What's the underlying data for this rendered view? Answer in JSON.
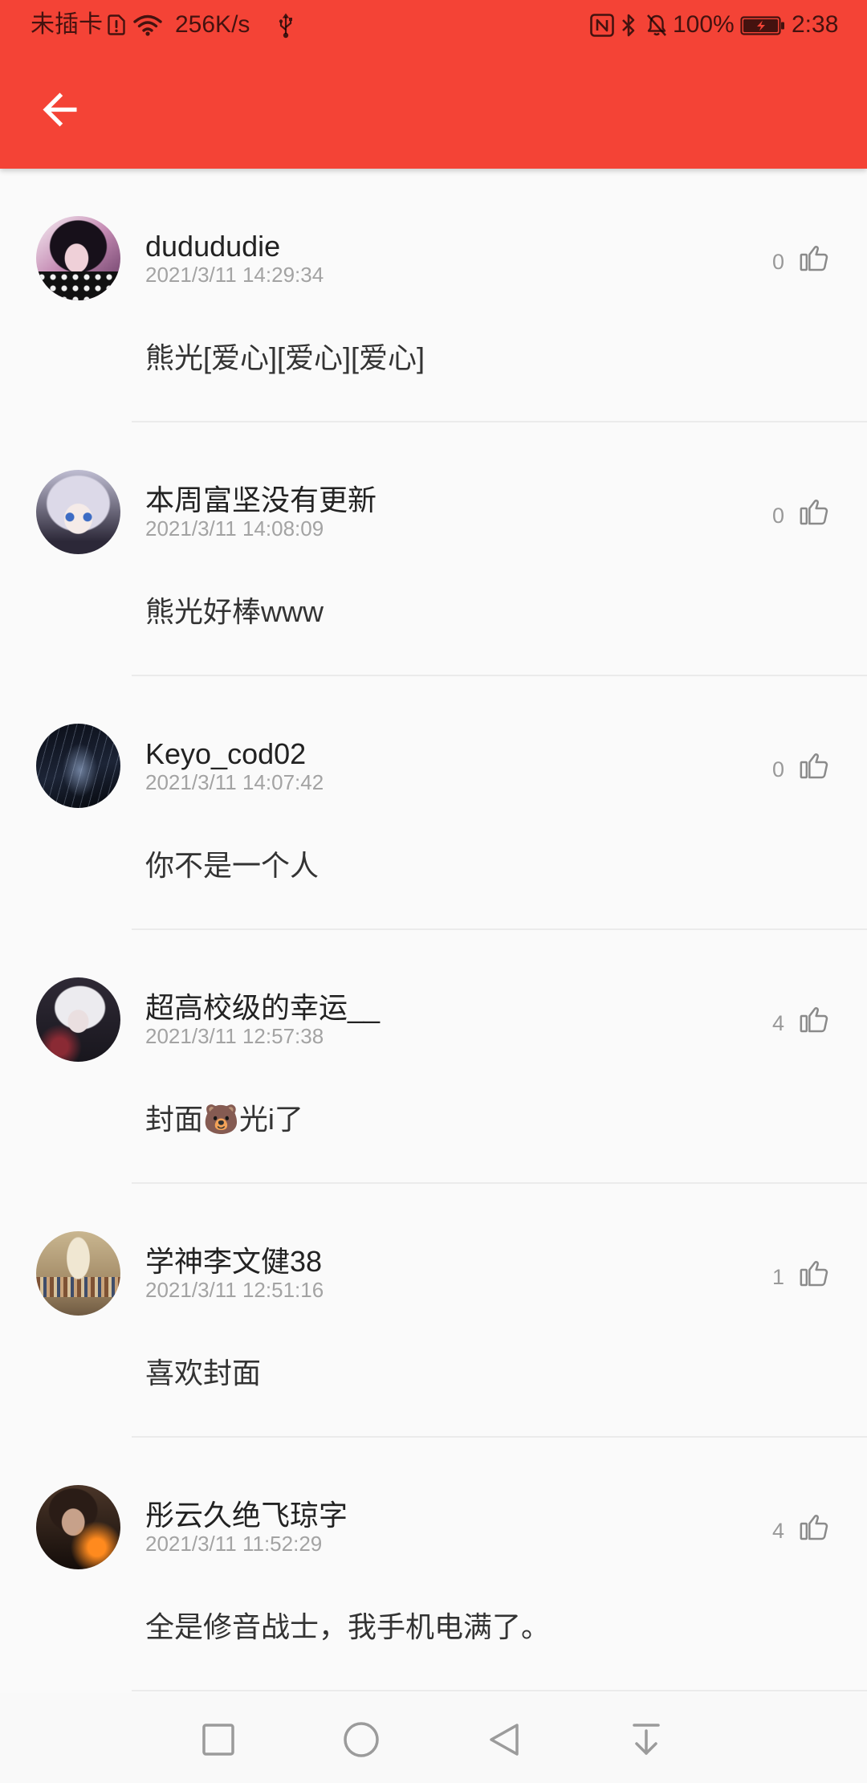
{
  "status_bar": {
    "carrier": "未插卡",
    "network_speed": "256K/s",
    "battery_percent": "100%",
    "battery_level": 1.0,
    "time": "2:38",
    "left_icons": [
      "sim-alert-icon",
      "wifi-icon",
      "usb-icon"
    ],
    "right_icons": [
      "nfc-icon",
      "bluetooth-icon",
      "mute-icon",
      "battery-charging-icon"
    ]
  },
  "theme": {
    "primary": "#F44336",
    "background": "#FAFAFA"
  },
  "toolbar": {
    "back_icon": "arrow-back-icon"
  },
  "comments": [
    {
      "username": "dudududie",
      "time": "2021/3/11 14:29:34",
      "likes": 0,
      "text": "熊光[爱心][爱心][爱心]"
    },
    {
      "username": "本周富坚没有更新",
      "time": "2021/3/11 14:08:09",
      "likes": 0,
      "text": "熊光好棒www"
    },
    {
      "username": "Keyo_cod02",
      "time": "2021/3/11 14:07:42",
      "likes": 0,
      "text": "你不是一个人"
    },
    {
      "username": "超高校级的幸运__",
      "time": "2021/3/11 12:57:38",
      "likes": 4,
      "text": "封面🐻光i了"
    },
    {
      "username": "学神李文健38",
      "time": "2021/3/11 12:51:16",
      "likes": 1,
      "text": "喜欢封面"
    },
    {
      "username": "彤云久绝飞琼字",
      "time": "2021/3/11 11:52:29",
      "likes": 4,
      "text": "全是修音战士，我手机电满了。"
    }
  ],
  "like_icon": "thumb-up-outline-icon",
  "nav_bar": {
    "icons": [
      "recent-apps-icon",
      "home-icon",
      "back-icon",
      "notification-pulldown-icon"
    ]
  }
}
